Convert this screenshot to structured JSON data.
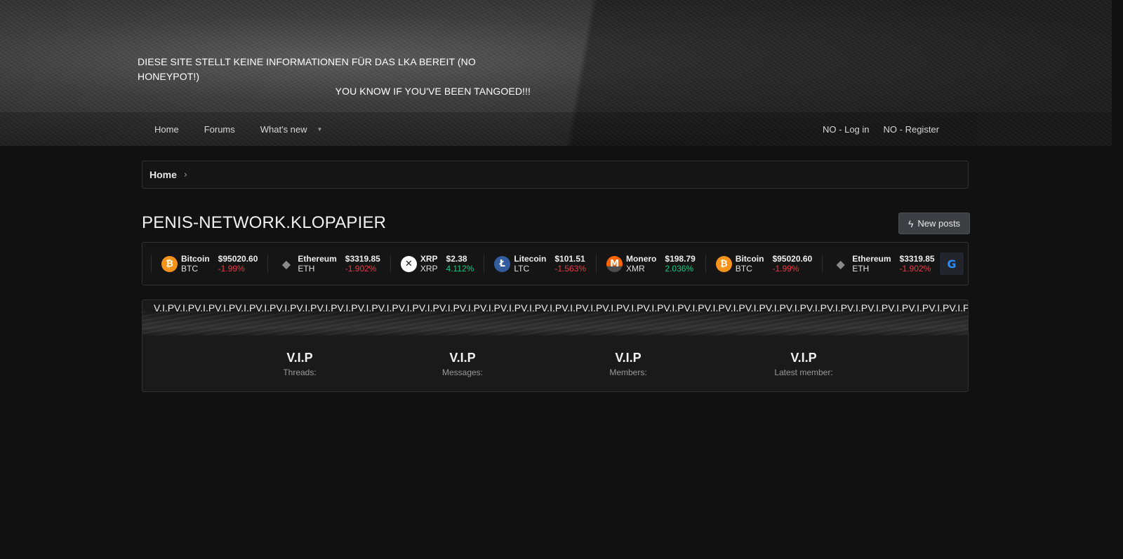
{
  "header": {
    "notice_line1": "DIESE SITE STELLT KEINE INFORMATIONEN FÜR DAS LKA BEREIT (NO HONEYPOT!)",
    "notice_line2": "YOU KNOW IF YOU'VE BEEN TANGOED!!!"
  },
  "nav": {
    "items": [
      {
        "label": "Home"
      },
      {
        "label": "Forums"
      },
      {
        "label": "What's new"
      }
    ],
    "login": "NO - Log in",
    "register": "NO - Register"
  },
  "breadcrumb": {
    "home": "Home",
    "sep": "›"
  },
  "page": {
    "title": "PENIS-NETWORK.KLOPAPIER",
    "new_posts": "New posts"
  },
  "ticker": {
    "coins": [
      {
        "name": "Bitcoin",
        "symbol": "BTC",
        "price": "$95020.60",
        "change": "-1.99%",
        "direction": "neg",
        "icon": "bitcoin-icon",
        "color": "#f7931a",
        "glyph": "₿"
      },
      {
        "name": "Ethereum",
        "symbol": "ETH",
        "price": "$3319.85",
        "change": "-1.902%",
        "direction": "neg",
        "icon": "ethereum-icon",
        "color": "#151516",
        "glyph": "◆"
      },
      {
        "name": "XRP",
        "symbol": "XRP",
        "price": "$2.38",
        "change": "4.112%",
        "direction": "pos",
        "icon": "xrp-icon",
        "color": "#ffffff",
        "glyph": "✕"
      },
      {
        "name": "Litecoin",
        "symbol": "LTC",
        "price": "$101.51",
        "change": "-1.563%",
        "direction": "neg",
        "icon": "litecoin-icon",
        "color": "#345d9d",
        "glyph": "Ł"
      },
      {
        "name": "Monero",
        "symbol": "XMR",
        "price": "$198.79",
        "change": "2.036%",
        "direction": "pos",
        "icon": "monero-icon",
        "color": "#ff6600",
        "glyph": "M"
      },
      {
        "name": "Bitcoin",
        "symbol": "BTC",
        "price": "$95020.60",
        "change": "-1.99%",
        "direction": "neg",
        "icon": "bitcoin-icon",
        "color": "#f7931a",
        "glyph": "₿"
      },
      {
        "name": "Ethereum",
        "symbol": "ETH",
        "price": "$3319.85",
        "change": "-1.902%",
        "direction": "neg",
        "icon": "ethereum-icon",
        "color": "#151516",
        "glyph": "◆"
      }
    ],
    "badge": "G"
  },
  "stats": {
    "marquee": "V.I.PV.I.PV.I.PV.I.PV.I.PV.I.PV.I.PV.I.PV.I.PV.I.PV.I.PV.I.PV.I.PV.I.PV.I.PV.I.PV.I.PV.I.PV.I.PV.I.PV.I.PV.I.PV.I.PV.I.PV.I.PV.I.PV.I.PV.I.PV.I.PV.I.PV.I.PV.I.PV.I.PV.I.PV.I.PV.I.PV.I.PV.I.PV.I.PV.I.PV.I.PV.I.PV.I.PV.I.PV.I.PV.I.P",
    "items": [
      {
        "value": "V.I.P",
        "label": "Threads:"
      },
      {
        "value": "V.I.P",
        "label": "Messages:"
      },
      {
        "value": "V.I.P",
        "label": "Members:"
      },
      {
        "value": "V.I.P",
        "label": "Latest member:"
      }
    ]
  }
}
